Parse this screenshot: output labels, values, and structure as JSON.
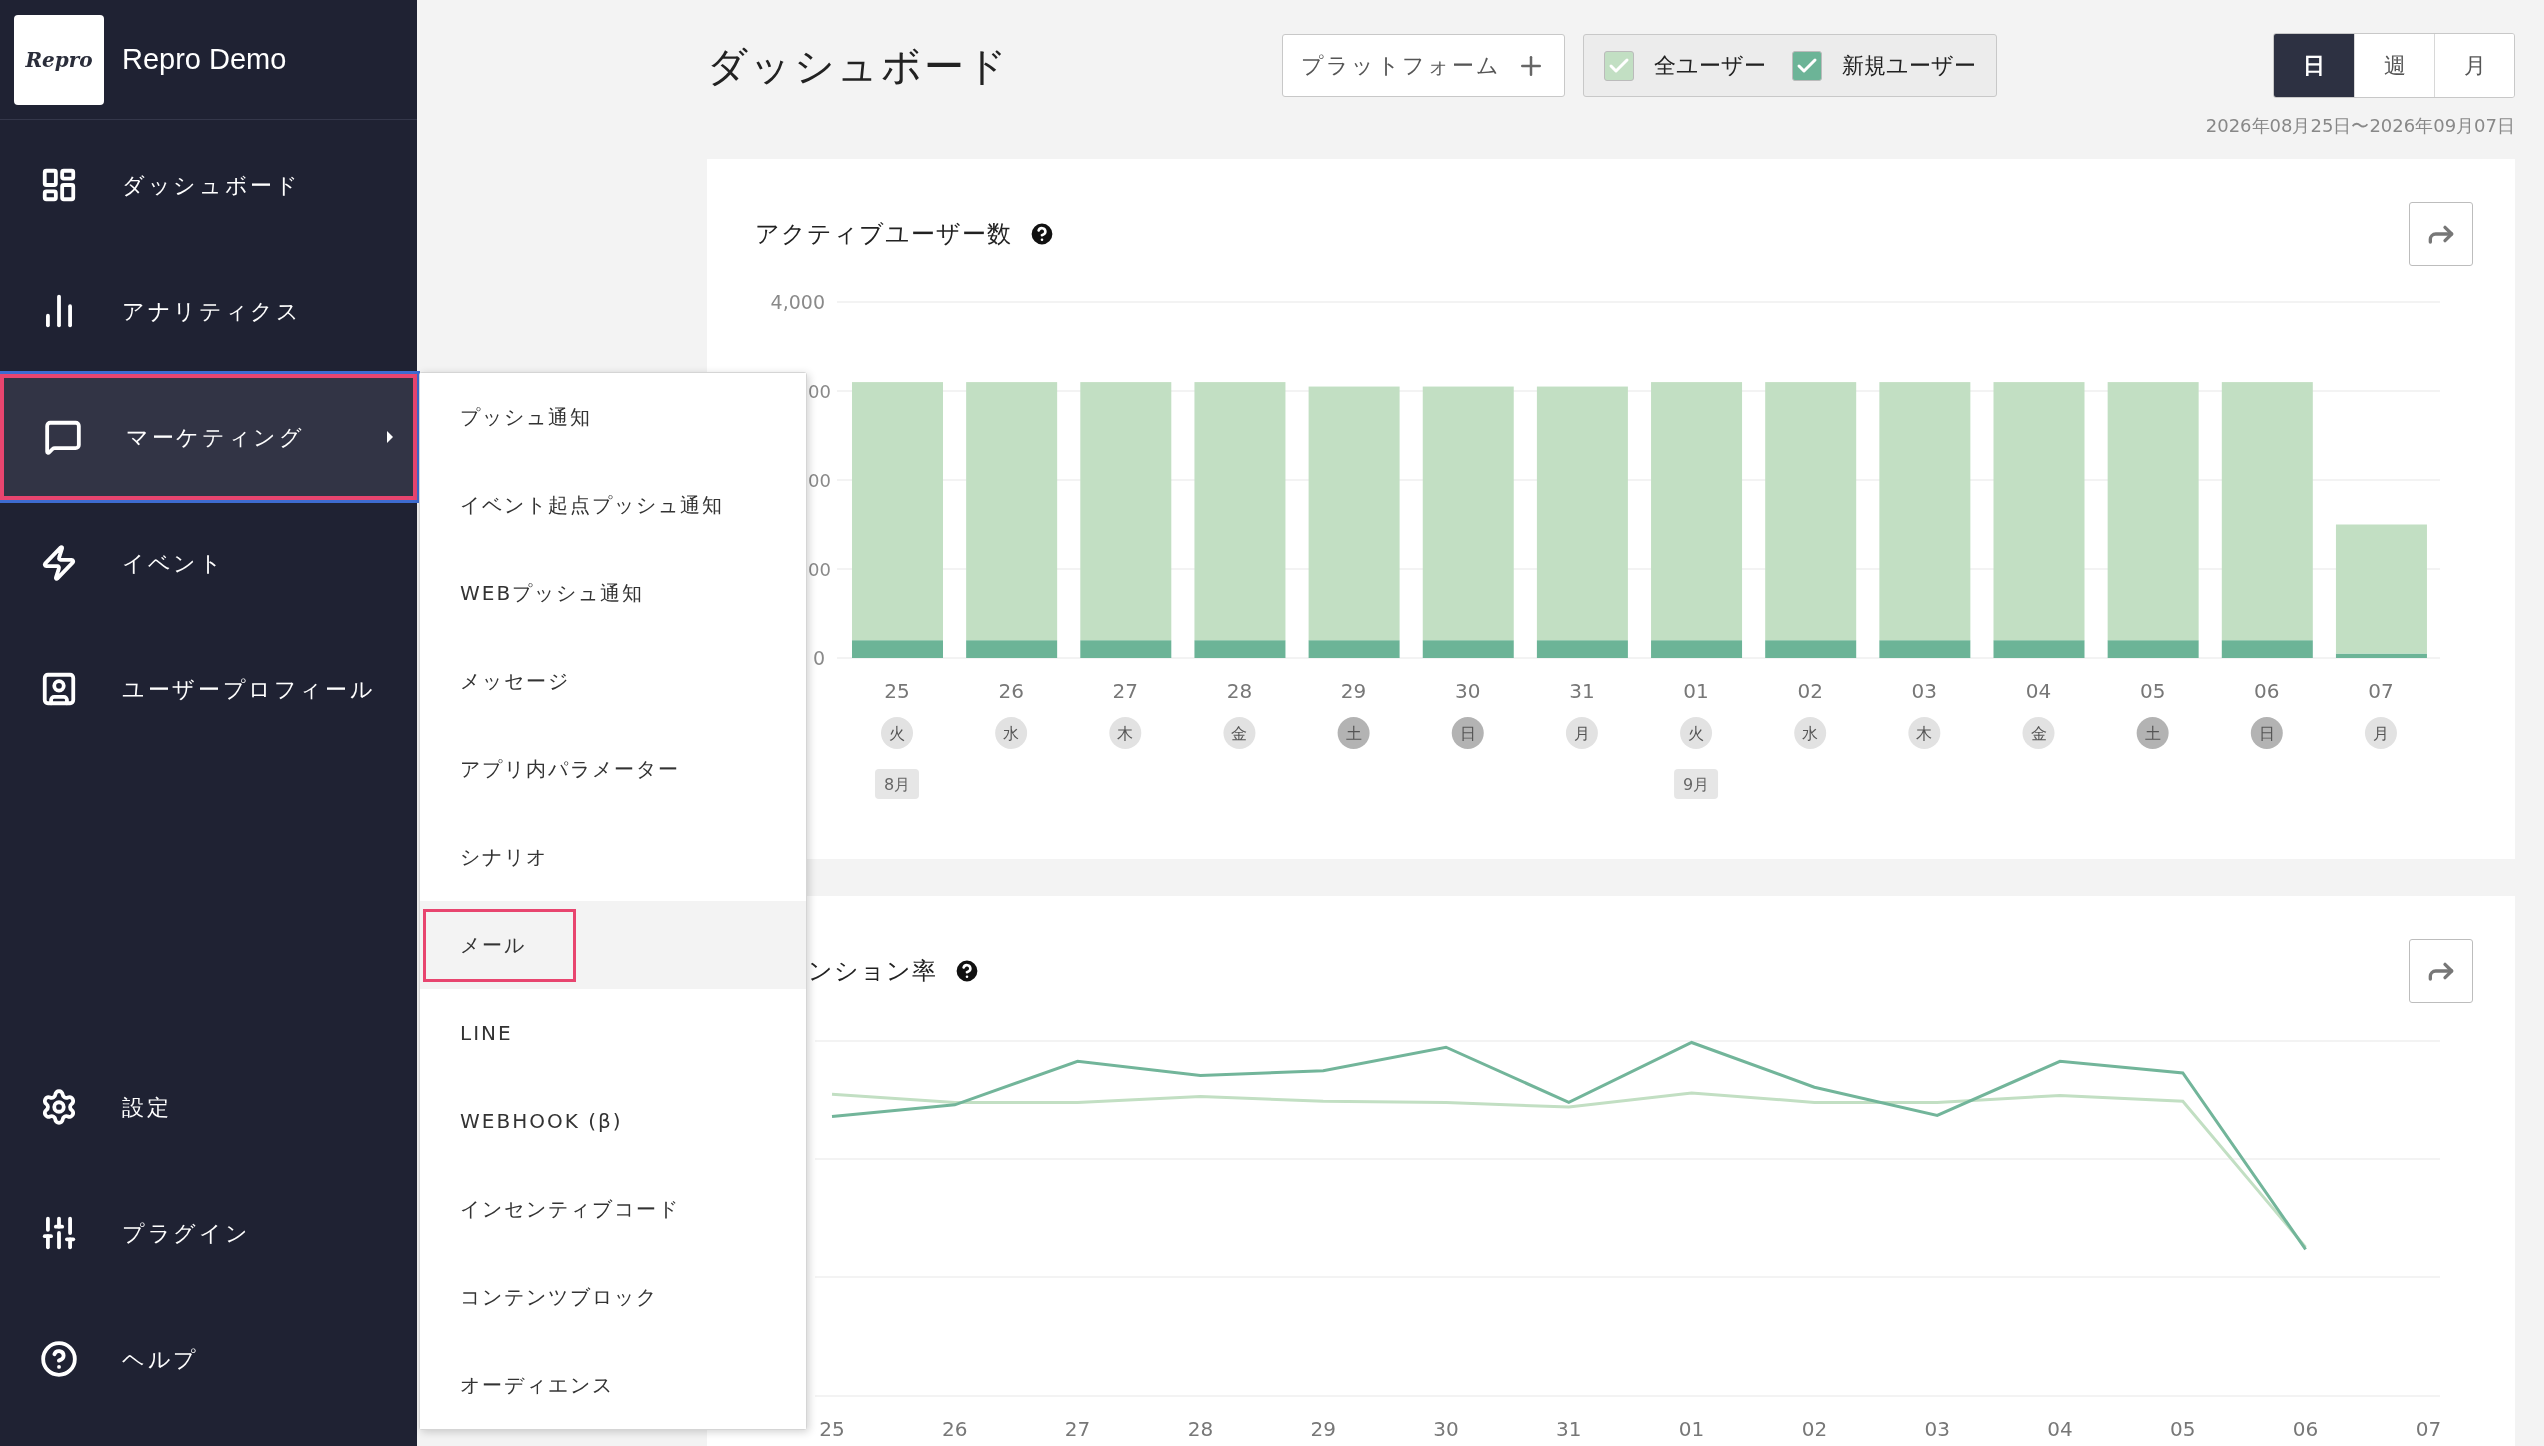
{
  "sidebar": {
    "logo": "Repro",
    "app_name": "Repro Demo",
    "top_items": [
      {
        "label": "ダッシュボード",
        "selected": false,
        "has_submenu": false
      },
      {
        "label": "アナリティクス",
        "selected": false,
        "has_submenu": false
      },
      {
        "label": "マーケティング",
        "selected": true,
        "has_submenu": true
      },
      {
        "label": "イベント",
        "selected": false,
        "has_submenu": false
      },
      {
        "label": "ユーザープロフィール",
        "selected": false,
        "has_submenu": false
      }
    ],
    "bottom_items": [
      {
        "label": "設定",
        "selected": false
      },
      {
        "label": "プラグイン",
        "selected": false
      },
      {
        "label": "ヘルプ",
        "selected": false
      }
    ]
  },
  "submenu": {
    "items": [
      {
        "label": "プッシュ通知",
        "selected": false
      },
      {
        "label": "イベント起点プッシュ通知",
        "selected": false
      },
      {
        "label": "WEBプッシュ通知",
        "selected": false
      },
      {
        "label": "メッセージ",
        "selected": false
      },
      {
        "label": "アプリ内パラメーター",
        "selected": false
      },
      {
        "label": "シナリオ",
        "selected": false
      },
      {
        "label": "メール",
        "selected": true
      },
      {
        "label": "LINE",
        "selected": false
      },
      {
        "label": "WEBHOOK (β)",
        "selected": false
      },
      {
        "label": "インセンティブコード",
        "selected": false
      },
      {
        "label": "コンテンツブロック",
        "selected": false
      },
      {
        "label": "オーディエンス",
        "selected": false
      }
    ]
  },
  "header": {
    "title": "ダッシュボード",
    "platform_button": "プラットフォーム",
    "user_filters": [
      {
        "label": "全ユーザー",
        "checked": true,
        "color": "#c2dfc3"
      },
      {
        "label": "新規ユーザー",
        "checked": true,
        "color": "#6cb497"
      }
    ],
    "periods": [
      {
        "label": "日",
        "selected": true
      },
      {
        "label": "週",
        "selected": false
      },
      {
        "label": "月",
        "selected": false
      }
    ],
    "date_range": "2026年08月25日〜2026年09月07日"
  },
  "active_users_card": {
    "title": "アクティブユーザー数",
    "chart_data": {
      "type": "bar",
      "stacked": true,
      "grid": true,
      "categories": [
        "25",
        "26",
        "27",
        "28",
        "29",
        "30",
        "31",
        "01",
        "02",
        "03",
        "04",
        "05",
        "06",
        "07"
      ],
      "series": [
        {
          "color": "#6cb497",
          "values": [
            200,
            200,
            200,
            200,
            200,
            200,
            200,
            200,
            200,
            200,
            200,
            200,
            200,
            50
          ]
        },
        {
          "color": "#c2dfc3",
          "values": [
            2900,
            2900,
            2900,
            2900,
            2850,
            2850,
            2850,
            2900,
            2900,
            2900,
            2900,
            2900,
            2900,
            1450
          ]
        }
      ],
      "ylim": [
        0,
        4000
      ],
      "yticks": [
        0,
        {
          "value": 4000,
          "label": "4,000"
        }
      ]
    },
    "partial_tick_labels": [
      "00",
      "00",
      "00"
    ],
    "days": [
      {
        "weekday": "火",
        "weekend": false,
        "month": "8月"
      },
      {
        "weekday": "水",
        "weekend": false
      },
      {
        "weekday": "木",
        "weekend": false
      },
      {
        "weekday": "金",
        "weekend": false
      },
      {
        "weekday": "土",
        "weekend": true
      },
      {
        "weekday": "日",
        "weekend": true
      },
      {
        "weekday": "月",
        "weekend": false
      },
      {
        "weekday": "火",
        "weekend": false,
        "month": "9月"
      },
      {
        "weekday": "水",
        "weekend": false
      },
      {
        "weekday": "木",
        "weekend": false
      },
      {
        "weekday": "金",
        "weekend": false
      },
      {
        "weekday": "土",
        "weekend": true
      },
      {
        "weekday": "日",
        "weekend": true
      },
      {
        "weekday": "月",
        "weekend": false
      }
    ]
  },
  "retention_card": {
    "title": "ンション率",
    "x_labels": [
      "25",
      "26",
      "27",
      "28",
      "29",
      "30",
      "31",
      "01",
      "02",
      "03",
      "04",
      "05",
      "06",
      "07"
    ]
  }
}
